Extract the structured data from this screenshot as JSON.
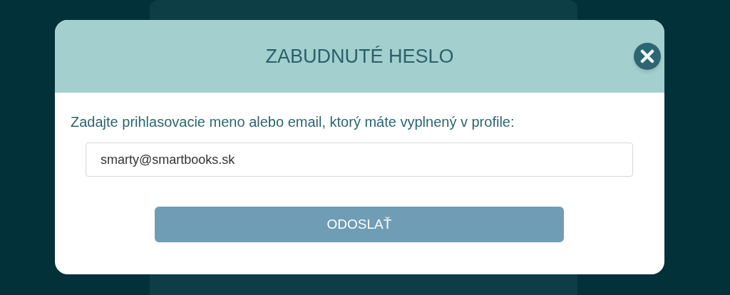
{
  "dialog": {
    "title": "ZABUDNUTÉ HESLO",
    "prompt": "Zadajte prihlasovacie meno alebo email, ktorý máte vyplnený v profile:",
    "field": {
      "value": "smarty@smartbooks.sk"
    },
    "submit": "ODOSLAŤ"
  }
}
